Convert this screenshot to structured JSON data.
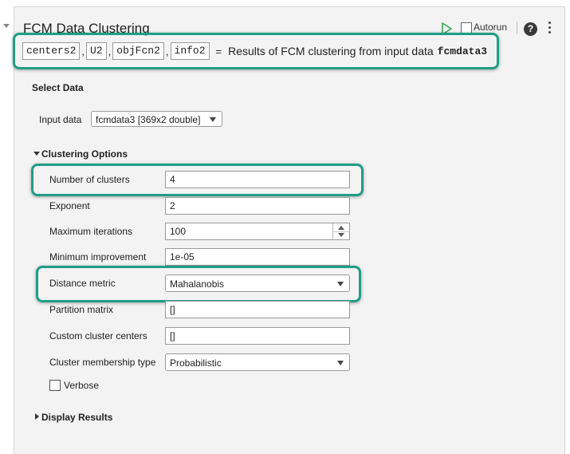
{
  "title": "FCM Data Clustering",
  "header": {
    "autorun_label": "Autorun",
    "help_glyph": "?"
  },
  "code": {
    "outputs": [
      "centers2",
      "U2",
      "objFcn2",
      "info2"
    ],
    "separator": ",",
    "equals": "=",
    "description": "Results of FCM clustering from input data",
    "input_var": "fcmdata3"
  },
  "select_data": {
    "heading": "Select Data",
    "input_label": "Input data",
    "input_value": "fcmdata3 [369x2 double]"
  },
  "clustering": {
    "heading": "Clustering Options",
    "num_clusters_label": "Number of clusters",
    "num_clusters_value": "4",
    "exponent_label": "Exponent",
    "exponent_value": "2",
    "max_iter_label": "Maximum iterations",
    "max_iter_value": "100",
    "min_improve_label": "Minimum improvement",
    "min_improve_value": "1e-05",
    "distance_label": "Distance metric",
    "distance_value": "Mahalanobis",
    "partition_label": "Partition matrix",
    "partition_value": "[]",
    "custom_centers_label": "Custom cluster centers",
    "custom_centers_value": "[]",
    "membership_label": "Cluster membership type",
    "membership_value": "Probabilistic",
    "verbose_label": "Verbose",
    "verbose_checked": false
  },
  "display_results": {
    "heading": "Display Results"
  },
  "colors": {
    "highlight": "#1f9e84",
    "run_icon": "#2fa84f",
    "panel_bg": "#f3f3f3"
  }
}
